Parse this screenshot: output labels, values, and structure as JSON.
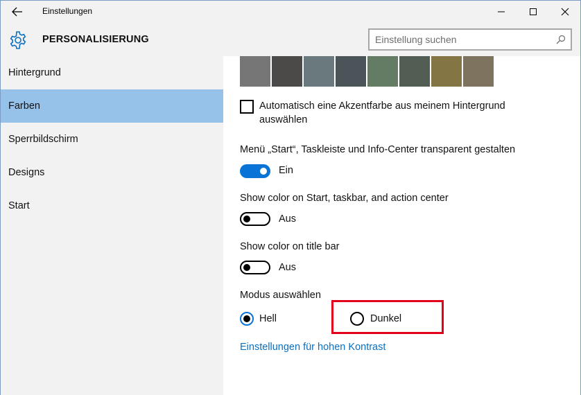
{
  "window": {
    "title": "Einstellungen"
  },
  "header": {
    "title": "PERSONALISIERUNG",
    "search_placeholder": "Einstellung suchen"
  },
  "sidebar": {
    "items": [
      {
        "label": "Hintergrund"
      },
      {
        "label": "Farben",
        "active": true
      },
      {
        "label": "Sperrbildschirm"
      },
      {
        "label": "Designs"
      },
      {
        "label": "Start"
      }
    ]
  },
  "colors": {
    "swatches": [
      "#767676",
      "#4c4a48",
      "#69797e",
      "#4a5459",
      "#647c64",
      "#525e54",
      "#847545",
      "#7e735f"
    ],
    "accent": "#0a74d6",
    "highlight": "#e3001b"
  },
  "main": {
    "auto_accent_label": "Automatisch eine Akzentfarbe aus meinem Hintergrund auswählen",
    "transparent_label": "Menü „Start“, Taskleiste und Info-Center transparent gestalten",
    "transparent_state": "Ein",
    "start_color_label": "Show color on Start, taskbar, and action center",
    "start_color_state": "Aus",
    "titlebar_color_label": "Show color on title bar",
    "titlebar_color_state": "Aus",
    "mode_label": "Modus auswählen",
    "mode_light": "Hell",
    "mode_dark": "Dunkel",
    "high_contrast_link": "Einstellungen für hohen Kontrast"
  }
}
